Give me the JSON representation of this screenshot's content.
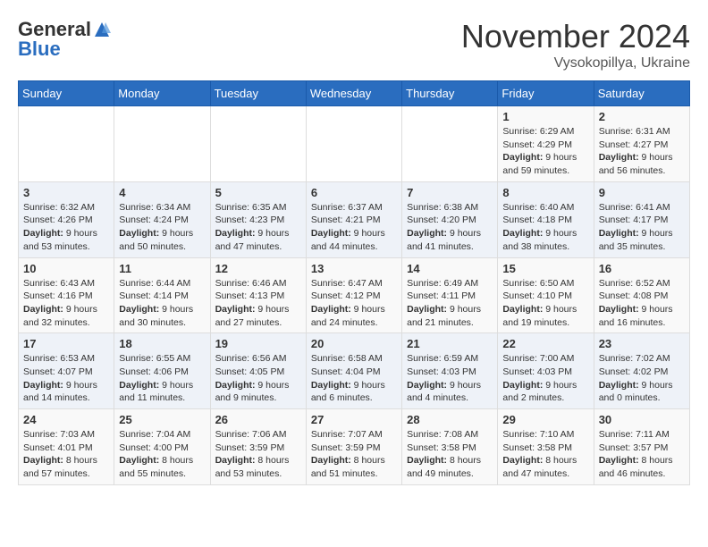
{
  "header": {
    "logo_general": "General",
    "logo_blue": "Blue",
    "month_title": "November 2024",
    "location": "Vysokopillya, Ukraine"
  },
  "weekdays": [
    "Sunday",
    "Monday",
    "Tuesday",
    "Wednesday",
    "Thursday",
    "Friday",
    "Saturday"
  ],
  "weeks": [
    [
      {
        "day": "",
        "content": ""
      },
      {
        "day": "",
        "content": ""
      },
      {
        "day": "",
        "content": ""
      },
      {
        "day": "",
        "content": ""
      },
      {
        "day": "",
        "content": ""
      },
      {
        "day": "1",
        "content": "Sunrise: 6:29 AM\nSunset: 4:29 PM\nDaylight: 9 hours and 59 minutes."
      },
      {
        "day": "2",
        "content": "Sunrise: 6:31 AM\nSunset: 4:27 PM\nDaylight: 9 hours and 56 minutes."
      }
    ],
    [
      {
        "day": "3",
        "content": "Sunrise: 6:32 AM\nSunset: 4:26 PM\nDaylight: 9 hours and 53 minutes."
      },
      {
        "day": "4",
        "content": "Sunrise: 6:34 AM\nSunset: 4:24 PM\nDaylight: 9 hours and 50 minutes."
      },
      {
        "day": "5",
        "content": "Sunrise: 6:35 AM\nSunset: 4:23 PM\nDaylight: 9 hours and 47 minutes."
      },
      {
        "day": "6",
        "content": "Sunrise: 6:37 AM\nSunset: 4:21 PM\nDaylight: 9 hours and 44 minutes."
      },
      {
        "day": "7",
        "content": "Sunrise: 6:38 AM\nSunset: 4:20 PM\nDaylight: 9 hours and 41 minutes."
      },
      {
        "day": "8",
        "content": "Sunrise: 6:40 AM\nSunset: 4:18 PM\nDaylight: 9 hours and 38 minutes."
      },
      {
        "day": "9",
        "content": "Sunrise: 6:41 AM\nSunset: 4:17 PM\nDaylight: 9 hours and 35 minutes."
      }
    ],
    [
      {
        "day": "10",
        "content": "Sunrise: 6:43 AM\nSunset: 4:16 PM\nDaylight: 9 hours and 32 minutes."
      },
      {
        "day": "11",
        "content": "Sunrise: 6:44 AM\nSunset: 4:14 PM\nDaylight: 9 hours and 30 minutes."
      },
      {
        "day": "12",
        "content": "Sunrise: 6:46 AM\nSunset: 4:13 PM\nDaylight: 9 hours and 27 minutes."
      },
      {
        "day": "13",
        "content": "Sunrise: 6:47 AM\nSunset: 4:12 PM\nDaylight: 9 hours and 24 minutes."
      },
      {
        "day": "14",
        "content": "Sunrise: 6:49 AM\nSunset: 4:11 PM\nDaylight: 9 hours and 21 minutes."
      },
      {
        "day": "15",
        "content": "Sunrise: 6:50 AM\nSunset: 4:10 PM\nDaylight: 9 hours and 19 minutes."
      },
      {
        "day": "16",
        "content": "Sunrise: 6:52 AM\nSunset: 4:08 PM\nDaylight: 9 hours and 16 minutes."
      }
    ],
    [
      {
        "day": "17",
        "content": "Sunrise: 6:53 AM\nSunset: 4:07 PM\nDaylight: 9 hours and 14 minutes."
      },
      {
        "day": "18",
        "content": "Sunrise: 6:55 AM\nSunset: 4:06 PM\nDaylight: 9 hours and 11 minutes."
      },
      {
        "day": "19",
        "content": "Sunrise: 6:56 AM\nSunset: 4:05 PM\nDaylight: 9 hours and 9 minutes."
      },
      {
        "day": "20",
        "content": "Sunrise: 6:58 AM\nSunset: 4:04 PM\nDaylight: 9 hours and 6 minutes."
      },
      {
        "day": "21",
        "content": "Sunrise: 6:59 AM\nSunset: 4:03 PM\nDaylight: 9 hours and 4 minutes."
      },
      {
        "day": "22",
        "content": "Sunrise: 7:00 AM\nSunset: 4:03 PM\nDaylight: 9 hours and 2 minutes."
      },
      {
        "day": "23",
        "content": "Sunrise: 7:02 AM\nSunset: 4:02 PM\nDaylight: 9 hours and 0 minutes."
      }
    ],
    [
      {
        "day": "24",
        "content": "Sunrise: 7:03 AM\nSunset: 4:01 PM\nDaylight: 8 hours and 57 minutes."
      },
      {
        "day": "25",
        "content": "Sunrise: 7:04 AM\nSunset: 4:00 PM\nDaylight: 8 hours and 55 minutes."
      },
      {
        "day": "26",
        "content": "Sunrise: 7:06 AM\nSunset: 3:59 PM\nDaylight: 8 hours and 53 minutes."
      },
      {
        "day": "27",
        "content": "Sunrise: 7:07 AM\nSunset: 3:59 PM\nDaylight: 8 hours and 51 minutes."
      },
      {
        "day": "28",
        "content": "Sunrise: 7:08 AM\nSunset: 3:58 PM\nDaylight: 8 hours and 49 minutes."
      },
      {
        "day": "29",
        "content": "Sunrise: 7:10 AM\nSunset: 3:58 PM\nDaylight: 8 hours and 47 minutes."
      },
      {
        "day": "30",
        "content": "Sunrise: 7:11 AM\nSunset: 3:57 PM\nDaylight: 8 hours and 46 minutes."
      }
    ]
  ]
}
